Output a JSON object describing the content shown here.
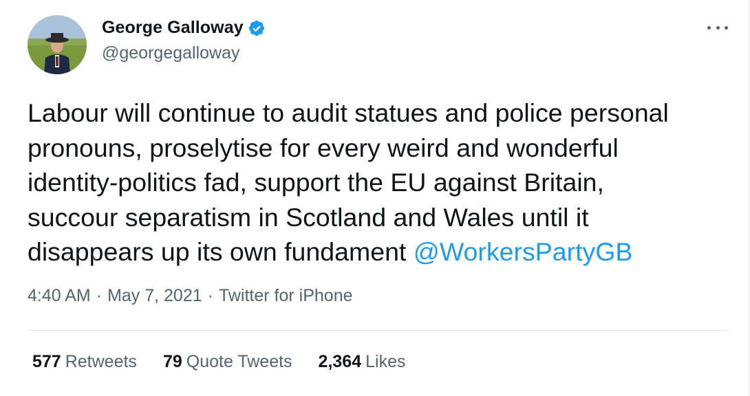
{
  "author": {
    "display_name": "George Galloway",
    "handle": "@georgegalloway",
    "verified": true,
    "avatar_icon": "profile-photo-man-in-hat"
  },
  "more_icon": "more-horizontal-icon",
  "tweet": {
    "text_parts": [
      "Labour will continue to audit statues and police personal\npronouns, proselytise for every weird and wonderful\nidentity-politics fad, support the EU against Britain,\nsuccour separatism in Scotland and Wales until it\ndisappears up its own fundament "
    ],
    "mention": "@WorkersPartyGB"
  },
  "meta": {
    "time": "4:40 AM",
    "separator": "·",
    "date": "May 7, 2021",
    "source": "Twitter for iPhone"
  },
  "stats": {
    "retweets_count": "577",
    "retweets_label": "Retweets",
    "quotes_count": "79",
    "quotes_label": "Quote Tweets",
    "likes_count": "2,364",
    "likes_label": "Likes"
  },
  "colors": {
    "accent": "#1d9bf0",
    "text": "#0f1419",
    "secondary": "#536471",
    "divider": "#e1e8ed"
  }
}
